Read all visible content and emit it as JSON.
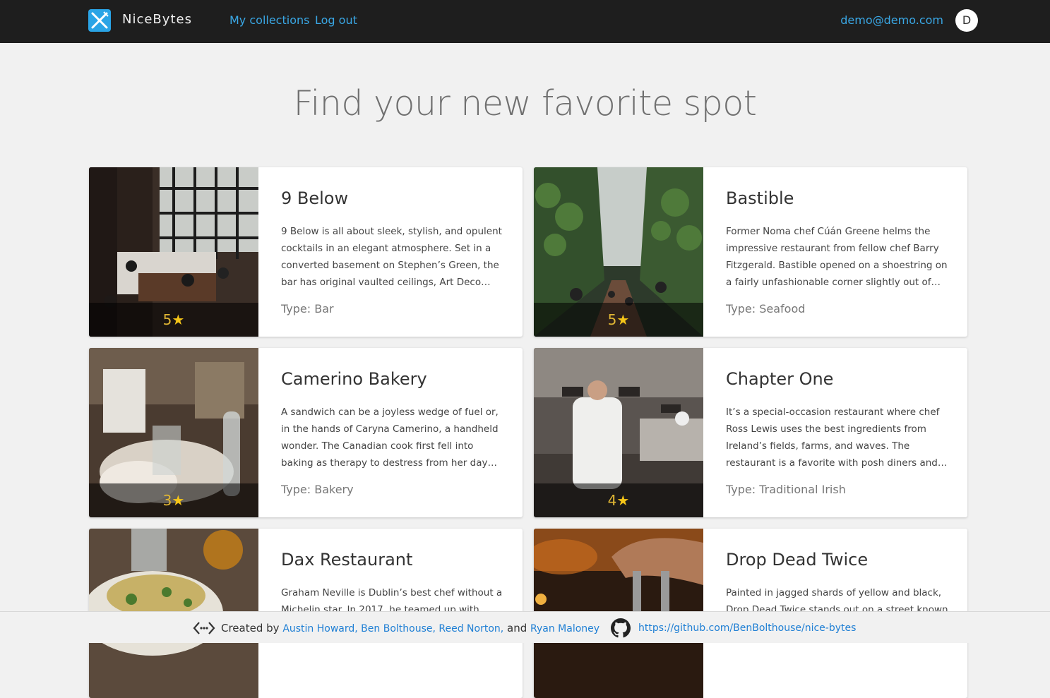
{
  "navbar": {
    "brand": "NiceBytes",
    "links": [
      "My collections",
      "Log out"
    ],
    "email": "demo@demo.com",
    "avatar_initial": "D",
    "logo_icon": "fork-knife-icon"
  },
  "hero": {
    "title": "Find your new favorite spot"
  },
  "restaurants": [
    {
      "name": "9 Below",
      "description": "9 Below is all about sleek, stylish, and opulent cocktails in an elegant atmosphere. Set in a converted basement on Stephen’s Green, the bar has original vaulted ceilings, Art Deco…",
      "type": "Type: Bar",
      "rating": "5",
      "star": "★"
    },
    {
      "name": "Bastible",
      "description": "Former Noma chef Cúán Greene helms the impressive restaurant from fellow chef Barry Fitzgerald. Bastible opened on a shoestring on a fairly unfashionable corner slightly out of…",
      "type": "Type: Seafood",
      "rating": "5",
      "star": "★"
    },
    {
      "name": "Camerino Bakery",
      "description": "A sandwich can be a joyless wedge of fuel or, in the hands of Caryna Camerino, a handheld wonder. The Canadian cook first fell into baking as therapy to destress from her day jo…",
      "type": "Type: Bakery",
      "rating": "3",
      "star": "★"
    },
    {
      "name": "Chapter One",
      "description": "It’s a special-occasion restaurant where chef Ross Lewis uses the best ingredients from Ireland’s fields, farms, and waves. The restaurant is a favorite with posh diners and…",
      "type": "Type: Traditional Irish",
      "rating": "4",
      "star": "★"
    },
    {
      "name": "Dax Restaurant",
      "description": "Graham Neville is Dublin’s best chef without a Michelin star. In 2017, he teamed up with",
      "type": "",
      "rating": "",
      "star": ""
    },
    {
      "name": "Drop Dead Twice",
      "description": "Painted in jagged shards of yellow and black, Drop Dead Twice stands out on a street known",
      "type": "",
      "rating": "",
      "star": ""
    }
  ],
  "footer": {
    "created_by": "Created by",
    "authors_main": "Austin Howard, Ben Bolthouse, Reed Norton,",
    "and": "and",
    "author_last": "Ryan Maloney",
    "repo_link": "https://github.com/BenBolthouse/nice-bytes",
    "code_icon": "code-icon",
    "github_icon": "github-icon"
  }
}
